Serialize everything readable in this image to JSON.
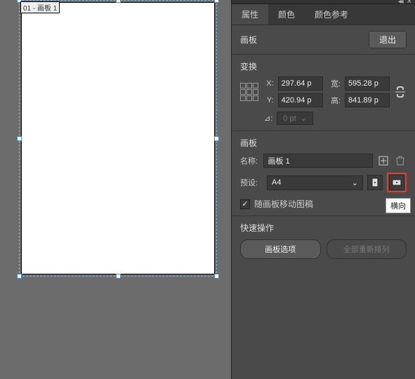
{
  "canvas": {
    "artboard_tag": "01 - 画板 1"
  },
  "tabs": {
    "properties": "属性",
    "color": "颜色",
    "color_ref": "颜色参考"
  },
  "header": {
    "title": "画板",
    "exit": "退出"
  },
  "transform": {
    "title": "变换",
    "x_label": "X:",
    "x": "297.64 p",
    "w_label": "宽:",
    "w": "595.28 p",
    "y_label": "Y:",
    "y": "420.94 p",
    "h_label": "高:",
    "h": "841.89 p",
    "angle_label": "⊿:",
    "angle": "0 pt",
    "angle_caret": "⌄"
  },
  "artboard": {
    "title": "画板",
    "name_label": "名称:",
    "name": "画板 1",
    "preset_label": "预设:",
    "preset": "A4",
    "move_artwork": "随画板移动图稿"
  },
  "quick": {
    "title": "快速操作",
    "options": "画板选项",
    "rearrange": "全部重新排列"
  },
  "tooltip": "横向"
}
